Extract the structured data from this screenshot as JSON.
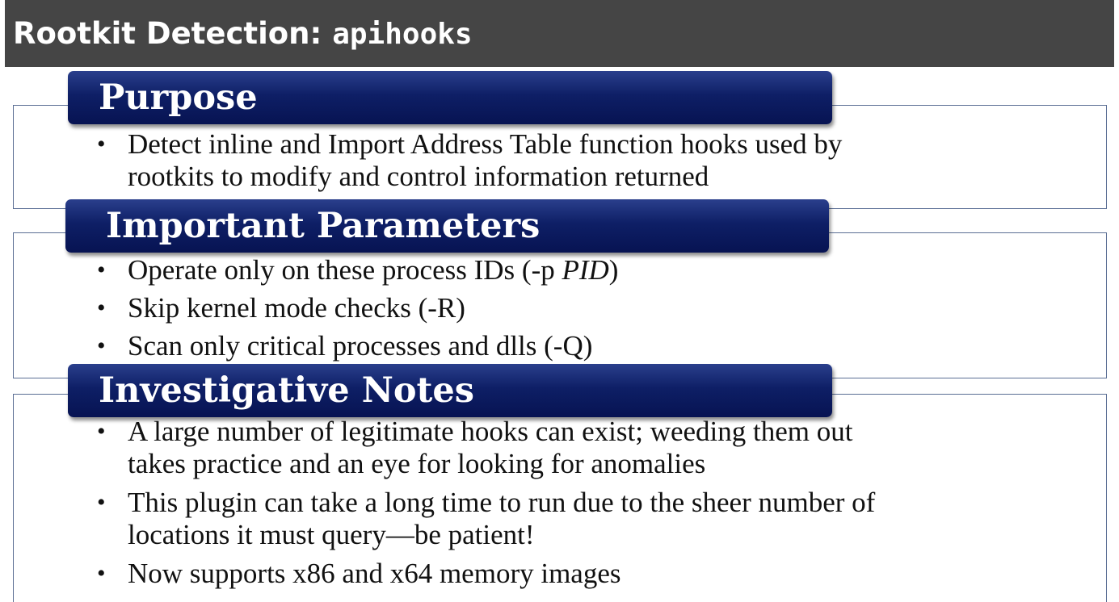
{
  "title": {
    "prefix": "Rootkit Detection: ",
    "command": "apihooks"
  },
  "sections": [
    {
      "heading": "Purpose",
      "bullets": [
        {
          "lines": [
            "Detect inline and Import Address Table function hooks used by",
            "rootkits to modify and control information returned"
          ]
        }
      ]
    },
    {
      "heading": "Important Parameters",
      "bullets": [
        {
          "text": "Operate only on these process IDs (-p ",
          "italic": "PID",
          "suffix": ")"
        },
        {
          "lines": [
            "Skip kernel mode checks (-R)"
          ]
        },
        {
          "lines": [
            "Scan only critical processes and dlls (-Q)"
          ]
        }
      ]
    },
    {
      "heading": "Investigative Notes",
      "bullets": [
        {
          "lines": [
            "A large number of legitimate hooks can exist; weeding them out",
            "takes practice and an eye for looking for anomalies"
          ]
        },
        {
          "lines": [
            "This plugin can take a long time to run due to the sheer number of",
            "locations it must query—be patient!"
          ]
        },
        {
          "lines": [
            "Now supports x86 and x64 memory images"
          ]
        }
      ]
    }
  ],
  "bullet_symbol": "•",
  "colors": {
    "title_bar": "#454545",
    "header_navy": "#0e1f66",
    "box_border": "#5a6e94"
  }
}
